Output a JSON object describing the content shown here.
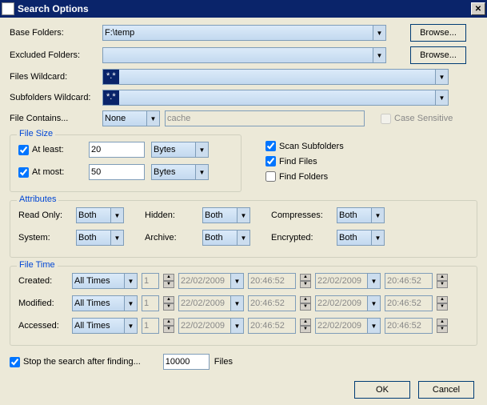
{
  "titlebar": {
    "title": "Search Options"
  },
  "labels": {
    "base_folders": "Base Folders:",
    "excluded_folders": "Excluded Folders:",
    "files_wildcard": "Files Wildcard:",
    "subfolders_wildcard": "Subfolders Wildcard:",
    "file_contains": "File Contains...",
    "case_sensitive": "Case Sensitive",
    "browse": "Browse...",
    "file_size": "File Size",
    "at_least": "At least:",
    "at_most": "At most:",
    "scan_subfolders": "Scan Subfolders",
    "find_files": "Find Files",
    "find_folders": "Find Folders",
    "attributes": "Attributes",
    "read_only": "Read Only:",
    "hidden": "Hidden:",
    "compresses": "Compresses:",
    "system": "System:",
    "archive": "Archive:",
    "encrypted": "Encrypted:",
    "file_time": "File Time",
    "created": "Created:",
    "modified": "Modified:",
    "accessed": "Accessed:",
    "stop_after": "Stop the search after finding...",
    "files_suffix": "Files",
    "ok": "OK",
    "cancel": "Cancel"
  },
  "values": {
    "base_folder": "F:\\temp",
    "excluded_folder": "",
    "files_wildcard": "*.*",
    "subfolders_wildcard": "*.*",
    "file_contains_mode": "None",
    "file_contains_text": "cache",
    "case_sensitive": false,
    "at_least_enabled": true,
    "at_least_value": "20",
    "at_least_unit": "Bytes",
    "at_most_enabled": true,
    "at_most_value": "50",
    "at_most_unit": "Bytes",
    "scan_subfolders": true,
    "find_files": true,
    "find_folders": false,
    "attr_read_only": "Both",
    "attr_hidden": "Both",
    "attr_compresses": "Both",
    "attr_system": "Both",
    "attr_archive": "Both",
    "attr_encrypted": "Both",
    "created_mode": "All Times",
    "created_count": "1",
    "created_date1": "22/02/2009",
    "created_time1": "20:46:52",
    "created_date2": "22/02/2009",
    "created_time2": "20:46:52",
    "modified_mode": "All Times",
    "modified_count": "1",
    "modified_date1": "22/02/2009",
    "modified_time1": "20:46:52",
    "modified_date2": "22/02/2009",
    "modified_time2": "20:46:52",
    "accessed_mode": "All Times",
    "accessed_count": "1",
    "accessed_date1": "22/02/2009",
    "accessed_time1": "20:46:52",
    "accessed_date2": "22/02/2009",
    "accessed_time2": "20:46:52",
    "stop_after_enabled": true,
    "stop_after_count": "10000"
  }
}
